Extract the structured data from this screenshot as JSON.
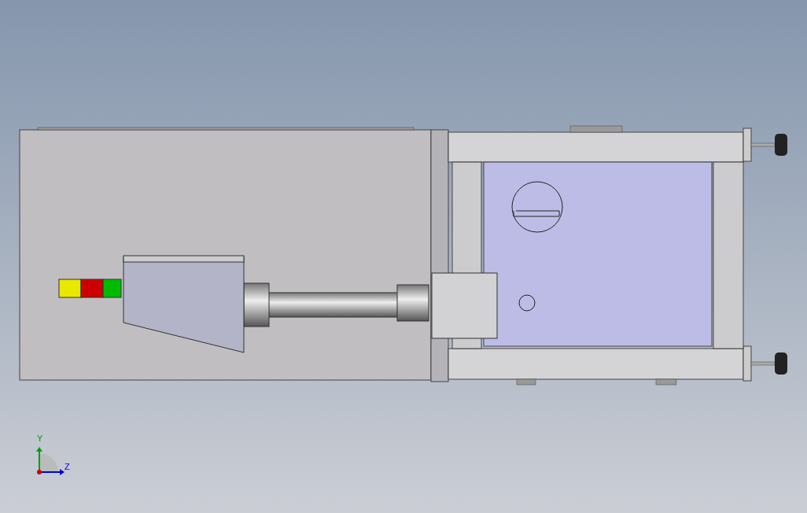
{
  "viewport": {
    "triad": {
      "axes": [
        {
          "label": "Y"
        },
        {
          "label": "Z"
        }
      ]
    }
  }
}
